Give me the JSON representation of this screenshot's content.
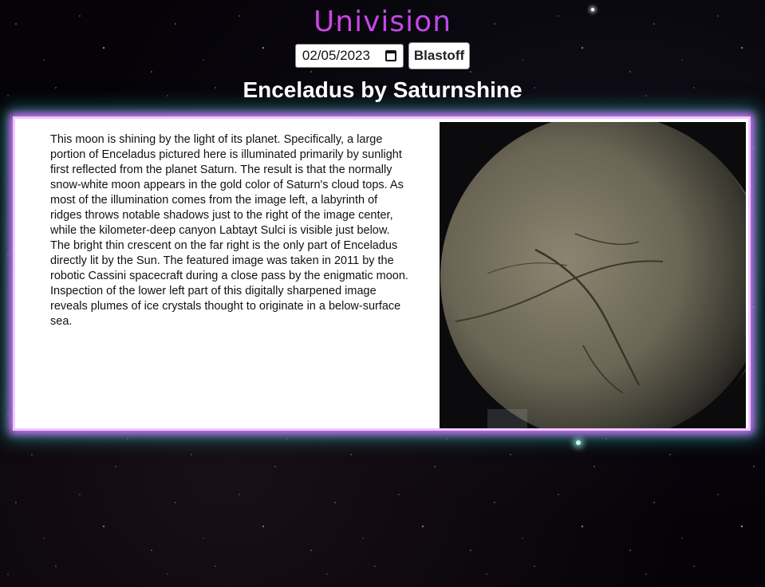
{
  "app": {
    "logo": "Univision"
  },
  "controls": {
    "date_value": "02/05/2023",
    "blast_label": "Blastoff"
  },
  "apod": {
    "title": "Enceladus by Saturnshine",
    "explanation": "This moon is shining by the light of its planet. Specifically, a large portion of Enceladus pictured here is illuminated primarily by sunlight first reflected from the planet Saturn. The result is that the normally snow-white moon appears in the gold color of Saturn's cloud tops. As most of the illumination comes from the image left, a labyrinth of ridges throws notable shadows just to the right of the image center, while the kilometer-deep canyon Labtayt Sulci is visible just below. The bright thin crescent on the far right is the only part of Enceladus directly lit by the Sun. The featured image was taken in 2011 by the robotic Cassini spacecraft during a close pass by the enigmatic moon. Inspection of the lower left part of this digitally sharpened image reveals plumes of ice crystals thought to originate in a below-surface sea."
  },
  "colors": {
    "logo_gradient_start": "#ff33cc",
    "logo_gradient_end": "#8a5cff",
    "card_glow_inner": "#d96cff",
    "card_glow_outer": "#28dcc8"
  }
}
